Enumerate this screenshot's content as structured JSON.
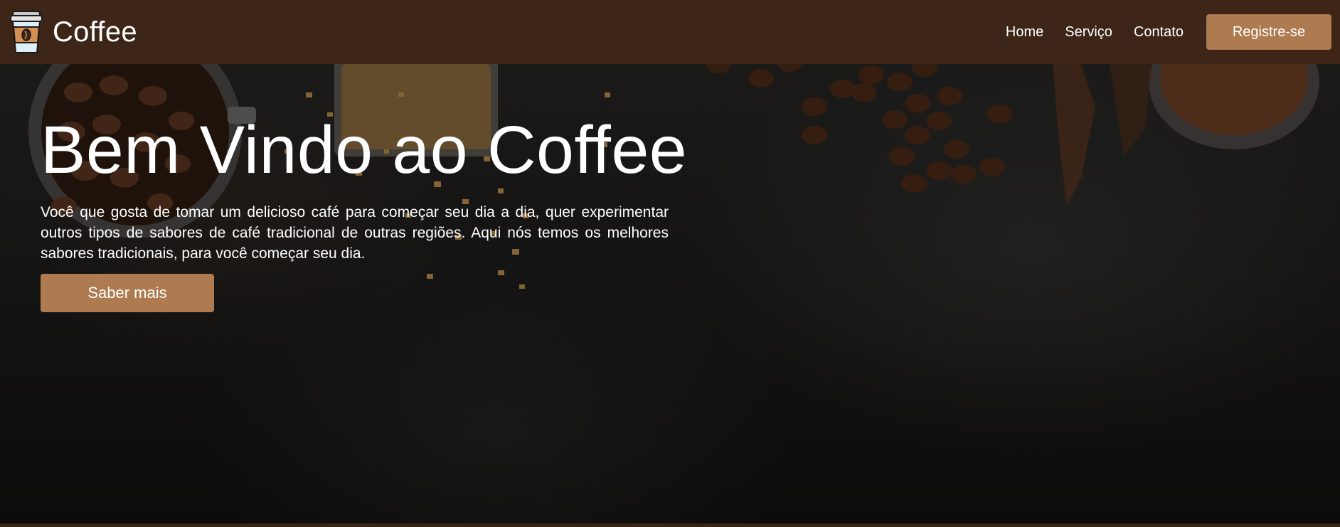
{
  "navbar": {
    "brand_name": "Coffee",
    "logo_icon": "coffee-cup-icon",
    "links": [
      "Home",
      "Serviço",
      "Contato"
    ],
    "register_label": "Registre-se"
  },
  "hero": {
    "title": "Bem Vindo ao Coffee",
    "text": "Você que gosta de tomar um delicioso café para começar seu dia a dia, quer experimentar outros tipos de sabores de café tradicional de outras regiões. Aqui nós temos os melhores sabores tradicionais, para você começar seu dia.",
    "button_label": "Saber mais"
  },
  "colors": {
    "navbar_bg": "#3d2618",
    "accent": "#ad7b4f",
    "text": "#ffffff"
  }
}
